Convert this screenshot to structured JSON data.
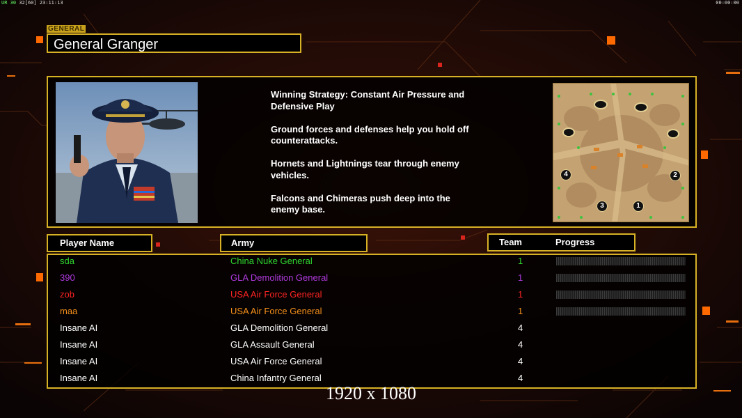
{
  "hud": {
    "prefix": "UR",
    "fps": "30",
    "fps2": "32",
    "bracket": "[60]",
    "clock": "23:11:13",
    "timer": "00:00:00"
  },
  "general": {
    "tag": "GENERAL",
    "name": "General Granger"
  },
  "strategy": [
    "Winning Strategy: Constant Air Pressure and\n Defensive Play",
    "Ground forces and defenses help you hold off\n counterattacks.",
    "Hornets and Lightnings tear through enemy\n vehicles.",
    "Falcons and Chimeras push deep into the\n enemy base."
  ],
  "minimap": {
    "start_positions": [
      "4",
      "2",
      "3",
      "1"
    ]
  },
  "headers": {
    "player_name": "Player Name",
    "army": "Army",
    "team": "Team",
    "progress": "Progress"
  },
  "players": [
    {
      "name": "sda",
      "army": "China Nuke General",
      "team": "1",
      "color": "#2fd62f",
      "progress": true
    },
    {
      "name": "390",
      "army": "GLA Demolition General",
      "team": "1",
      "color": "#b03ae0",
      "progress": true
    },
    {
      "name": "zob",
      "army": "USA Air Force General",
      "team": "1",
      "color": "#ff2424",
      "progress": true
    },
    {
      "name": "maa",
      "army": "USA Air Force General",
      "team": "1",
      "color": "#f5901c",
      "progress": true
    },
    {
      "name": "Insane AI",
      "army": "GLA Demolition General",
      "team": "4",
      "color": "#ffffff",
      "progress": false
    },
    {
      "name": "Insane AI",
      "army": "GLA Assault General",
      "team": "4",
      "color": "#ffffff",
      "progress": false
    },
    {
      "name": "Insane AI",
      "army": "USA Air Force General",
      "team": "4",
      "color": "#ffffff",
      "progress": false
    },
    {
      "name": "Insane AI",
      "army": "China Infantry General",
      "team": "4",
      "color": "#ffffff",
      "progress": false
    }
  ],
  "resolution_label": "1920 x 1080",
  "colors": {
    "frame": "#d8b225",
    "accent_orange": "#ff6a00"
  }
}
